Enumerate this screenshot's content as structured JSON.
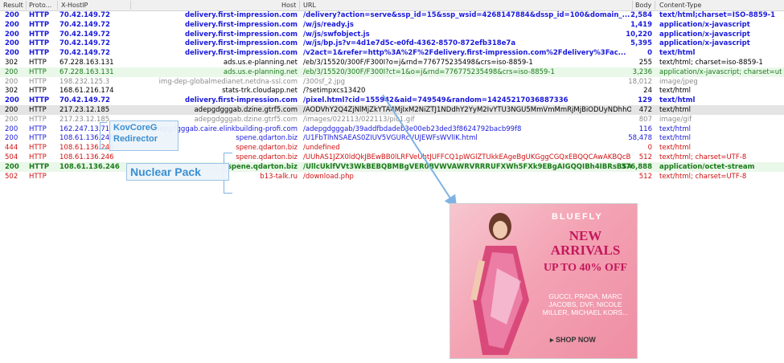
{
  "columns": [
    "Result",
    "Proto...",
    "X-HostIP",
    "Host",
    "URL",
    "Body",
    "Content-Type"
  ],
  "rows": [
    {
      "result": "200",
      "proto": "HTTP",
      "ip": "70.42.149.72",
      "host": "delivery.first-impression.com",
      "url": "/delivery?action=serve&ssp_id=15&ssp_wsid=4268147884&dssp_id=100&domain_...",
      "body": "2,584",
      "ct": "text/html;charset=ISO-8859-1",
      "style": "blue bold",
      "bg": ""
    },
    {
      "result": "200",
      "proto": "HTTP",
      "ip": "70.42.149.72",
      "host": "delivery.first-impression.com",
      "url": "/w/js/ready.js",
      "body": "1,419",
      "ct": "application/x-javascript",
      "style": "blue bold",
      "bg": ""
    },
    {
      "result": "200",
      "proto": "HTTP",
      "ip": "70.42.149.72",
      "host": "delivery.first-impression.com",
      "url": "/w/js/swfobject.js",
      "body": "10,220",
      "ct": "application/x-javascript",
      "style": "blue bold",
      "bg": ""
    },
    {
      "result": "200",
      "proto": "HTTP",
      "ip": "70.42.149.72",
      "host": "delivery.first-impression.com",
      "url": "/w/js/bp.js?v=4d1e7d5c-e0fd-4362-8570-872efb318e7a",
      "body": "5,395",
      "ct": "application/x-javascript",
      "style": "blue bold",
      "bg": ""
    },
    {
      "result": "200",
      "proto": "HTTP",
      "ip": "70.42.149.72",
      "host": "delivery.first-impression.com",
      "url": "/v2act=1&refer=http%3A%2F%2Fdelivery.first-impression.com%2Fdelivery%3Fac...",
      "body": "0",
      "ct": "text/html",
      "style": "blue bold",
      "bg": ""
    },
    {
      "result": "302",
      "proto": "HTTP",
      "ip": "67.228.163.131",
      "host": "ads.us.e-planning.net",
      "url": "/eb/3/15520/300F/F300I?o=j&rnd=776775235498&crs=iso-8859-1",
      "body": "255",
      "ct": "text/html; charset=iso-8859-1",
      "style": "black",
      "bg": ""
    },
    {
      "result": "200",
      "proto": "HTTP",
      "ip": "67.228.163.131",
      "host": "ads.us.e-planning.net",
      "url": "/eb/3/15520/300F/F300I?ct=1&o=j&rnd=776775235498&crs=iso-8859-1",
      "body": "3,236",
      "ct": "application/x-javascript; charset=utf-8",
      "style": "green",
      "bg": "bg-green"
    },
    {
      "result": "200",
      "proto": "HTTP",
      "ip": "198.232.125.3",
      "host": "img-dep-globalmedianet.netdna-ssl.com",
      "url": "/300sf_2.jpg",
      "body": "18,012",
      "ct": "image/jpeg",
      "style": "gray",
      "bg": ""
    },
    {
      "result": "302",
      "proto": "HTTP",
      "ip": "168.61.216.174",
      "host": "stats-trk.cloudapp.net",
      "url": "/?setimpxcs13420",
      "body": "24",
      "ct": "text/html",
      "style": "black",
      "bg": ""
    },
    {
      "result": "200",
      "proto": "HTTP",
      "ip": "70.42.149.72",
      "host": "delivery.first-impression.com",
      "url": "/pixel.html?cid=155942&aid=749549&random=14245217036887336",
      "body": "129",
      "ct": "text/html",
      "style": "blue bold",
      "bg": ""
    },
    {
      "result": "200",
      "proto": "HTTP",
      "ip": "217.23.12.185",
      "host": "adepgdgggab.dzine.gtrf5.com",
      "url": "/AODVhY2Q4ZjNlMjZkYTA4MjIxM2NiZTJ1NDdhY2YyM2IvYTU3NGU5MmVmMmRjMjBiODUyNDhhODM2...",
      "body": "472",
      "ct": "text/html",
      "style": "black",
      "bg": "bg-sel"
    },
    {
      "result": "200",
      "proto": "HTTP",
      "ip": "217.23.12.185",
      "host": "adepgdgggab.dzine.gtrf5.com",
      "url": "/images/022113/022113/pic1.gif",
      "body": "807",
      "ct": "image/gif",
      "style": "gray",
      "bg": ""
    },
    {
      "result": "200",
      "proto": "HTTP",
      "ip": "162.247.13.71",
      "host": "adepgdgggab.caire.elinkbuilding-profi.com",
      "url": "/adepgdgggab/39addfbdadeb3e00eb23ded3f8624792bacb99f8",
      "body": "116",
      "ct": "text/html",
      "style": "blue",
      "bg": ""
    },
    {
      "result": "200",
      "proto": "HTTP",
      "ip": "108.61.136.246",
      "host": "spene.qdarton.biz",
      "url": "/U1FbTlhNSAEAS0ZIUV5VGURcVUJEWFsWVlIK.html",
      "body": "58,478",
      "ct": "text/html",
      "style": "blue",
      "bg": ""
    },
    {
      "result": "444",
      "proto": "HTTP",
      "ip": "108.61.136.246",
      "host": "spene.qdarton.biz",
      "url": "/undefined",
      "body": "0",
      "ct": "text/html",
      "style": "red",
      "bg": ""
    },
    {
      "result": "504",
      "proto": "HTTP",
      "ip": "108.61.136.246",
      "host": "spene.qdarton.biz",
      "url": "/UUhAS1JZX0ldQkJBEwBB0lLRFVeUhtJUFFCQ1pWGlZTUkkEAgeBgUKGggCGQxEBQQCAwAKBQcB...",
      "body": "512",
      "ct": "text/html; charset=UTF-8",
      "style": "red",
      "bg": ""
    },
    {
      "result": "200",
      "proto": "HTTP",
      "ip": "108.61.136.246",
      "host": "spene.qdarton.biz",
      "url": "/UllcUklfVVt3WkBEBQBMBgVER0BVWVAWRVRRRUFXWh5FXk9EBgAIGQQIBh4IBRsBSAE...",
      "body": "376,888",
      "ct": "application/octet-stream",
      "style": "green bold",
      "bg": "bg-green"
    },
    {
      "result": "502",
      "proto": "HTTP",
      "ip": "",
      "host": "b13-talk.ru",
      "url": "/download.php",
      "body": "512",
      "ct": "text/html; charset=UTF-8",
      "style": "red",
      "bg": ""
    }
  ],
  "annotations": {
    "kovcoreg": "KovCoreG Redirector",
    "nuclear": "Nuclear Pack"
  },
  "ad": {
    "brand": "BLUEFLY",
    "headline": "NEW ARRIVALS",
    "offer": "UP TO 40% OFF",
    "brands_list": "GUCCI, PRADA, MARC JACOBS, DVF, NICOLE MILLER, MICHAEL KORS...",
    "cta": "SHOP NOW"
  },
  "colors": {
    "blue": "#1a1adc",
    "green": "#1a7a1a",
    "red": "#d01010",
    "gray": "#8c8c8c",
    "callout": "#3a8fd0"
  }
}
